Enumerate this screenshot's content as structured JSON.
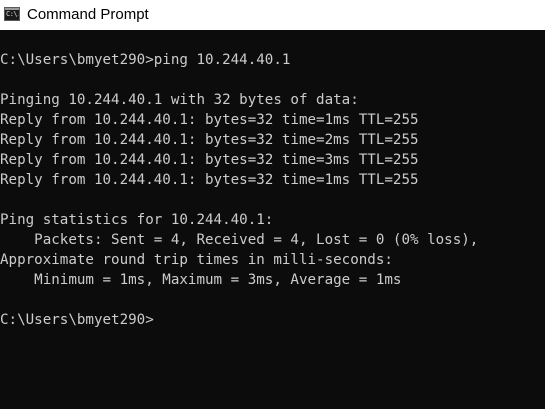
{
  "window": {
    "title": "Command Prompt",
    "icon": "cmd-window-icon",
    "icon_text": "C:\\."
  },
  "console": {
    "lines": [
      "C:\\Users\\bmyet290>ping 10.244.40.1",
      "",
      "Pinging 10.244.40.1 with 32 bytes of data:",
      "Reply from 10.244.40.1: bytes=32 time=1ms TTL=255",
      "Reply from 10.244.40.1: bytes=32 time=2ms TTL=255",
      "Reply from 10.244.40.1: bytes=32 time=3ms TTL=255",
      "Reply from 10.244.40.1: bytes=32 time=1ms TTL=255",
      "",
      "Ping statistics for 10.244.40.1:",
      "    Packets: Sent = 4, Received = 4, Lost = 0 (0% loss),",
      "Approximate round trip times in milli-seconds:",
      "    Minimum = 1ms, Maximum = 3ms, Average = 1ms",
      "",
      "C:\\Users\\bmyet290>"
    ]
  },
  "colors": {
    "background": "#0c0c0c",
    "text": "#cccccc",
    "titlebar": "#ffffff"
  }
}
